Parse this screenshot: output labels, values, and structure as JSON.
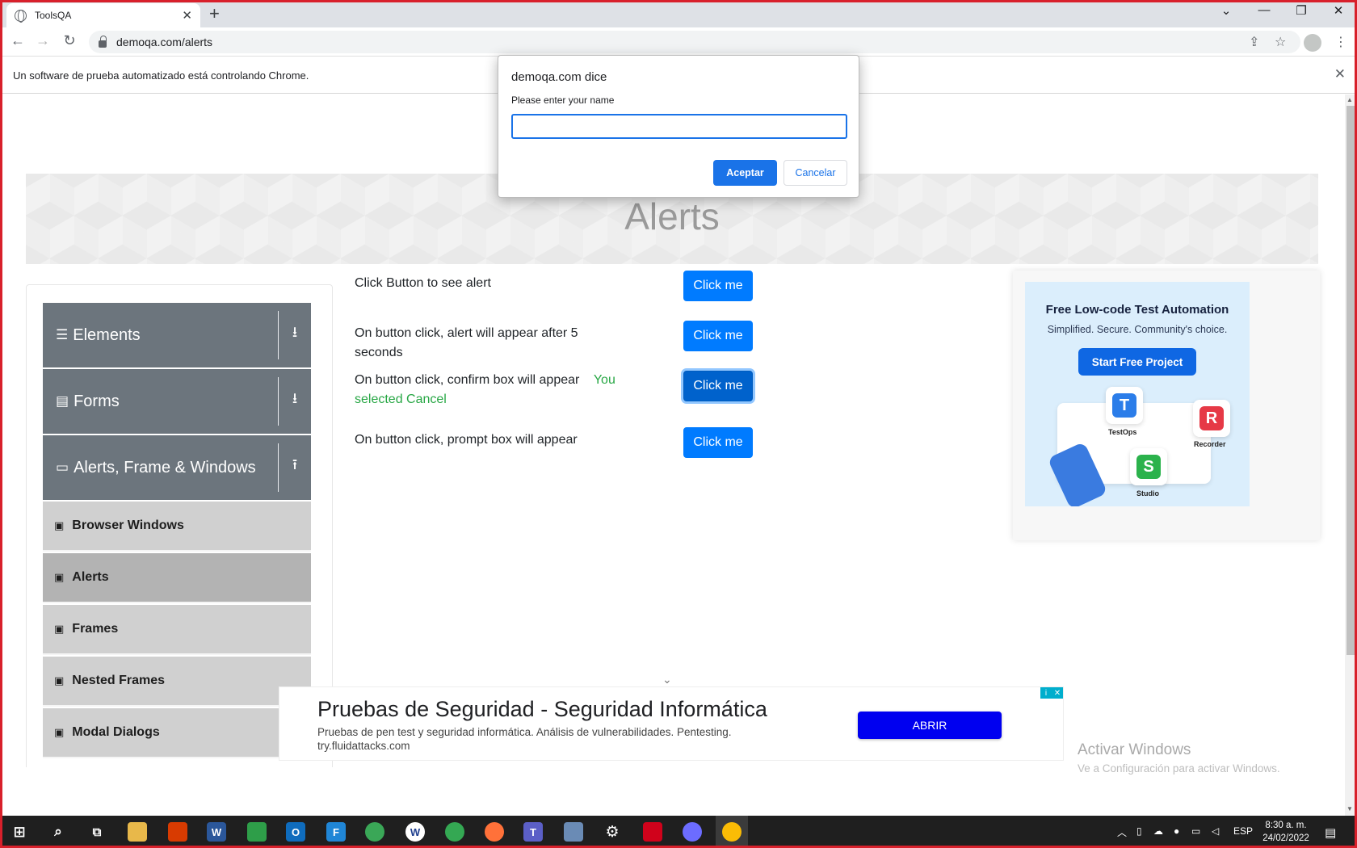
{
  "browser": {
    "tab_title": "ToolsQA",
    "url": "demoqa.com/alerts",
    "infobar_text": "Un software de prueba automatizado está controlando Chrome."
  },
  "dialog": {
    "title": "demoqa.com dice",
    "message": "Please enter your name",
    "input_value": "",
    "ok_label": "Aceptar",
    "cancel_label": "Cancelar"
  },
  "page": {
    "heading": "Alerts"
  },
  "sidebar": {
    "groups": [
      {
        "label": "Elements",
        "icon": "hamburger-icon",
        "arrow": "download-arrow-icon"
      },
      {
        "label": "Forms",
        "icon": "document-icon",
        "arrow": "download-arrow-icon"
      },
      {
        "label": "Alerts, Frame & Windows",
        "icon": "window-icon",
        "arrow": "upload-arrow-icon"
      }
    ],
    "items": [
      {
        "label": "Browser Windows",
        "active": false
      },
      {
        "label": "Alerts",
        "active": true
      },
      {
        "label": "Frames",
        "active": false
      },
      {
        "label": "Nested Frames",
        "active": false
      },
      {
        "label": "Modal Dialogs",
        "active": false
      }
    ]
  },
  "alerts": [
    {
      "text": "Click Button to see alert",
      "result": "",
      "button": "Click me"
    },
    {
      "text": "On button click, alert will appear after 5 seconds",
      "result": "",
      "button": "Click me"
    },
    {
      "text": "On button click, confirm box will appear",
      "result": "You selected Cancel",
      "button": "Click me"
    },
    {
      "text": "On button click, prompt box will appear",
      "result": "",
      "button": "Click me"
    }
  ],
  "ad_right": {
    "title": "Free Low-code Test Automation",
    "subtitle": "Simplified. Secure. Community's choice.",
    "cta": "Start Free Project",
    "products": [
      "TestOps",
      "Recorder",
      "Studio"
    ]
  },
  "ad_bottom": {
    "title": "Pruebas de Seguridad - Seguridad Informática",
    "description": "Pruebas de pen test y seguridad informática. Análisis de vulnerabilidades. Pentesting.",
    "url": "try.fluidattacks.com",
    "button": "ABRIR"
  },
  "watermark": {
    "line1": "Activar Windows",
    "line2": "Ve a Configuración para activar Windows."
  },
  "taskbar": {
    "language": "ESP",
    "time": "8:30 a. m.",
    "date": "24/02/2022"
  },
  "colors": {
    "primary_button": "#007bff",
    "result_text": "#28a745",
    "sidebar_group": "#6c757d",
    "sidebar_item": "#d0d0d0",
    "dialog_accent": "#1a73e8",
    "window_border": "#d8202b"
  }
}
